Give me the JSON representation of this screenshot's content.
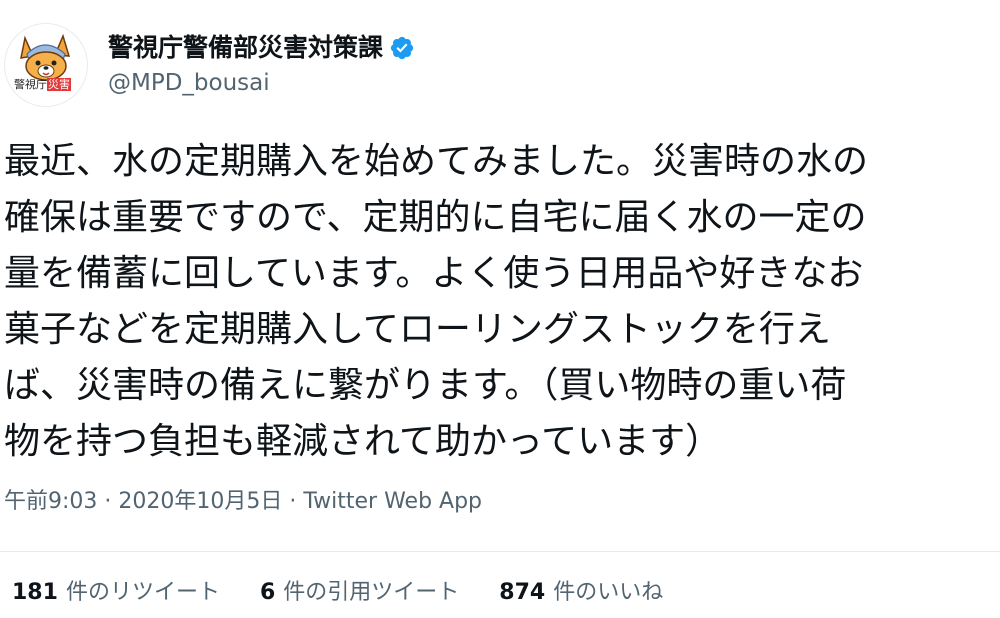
{
  "profile": {
    "display_name": "警視庁警備部災害対策課",
    "handle": "@MPD_bousai",
    "avatar_text_main": "警視庁",
    "avatar_text_tag": "災害",
    "verified_icon": "verified-badge-icon",
    "verified_color": "#1d9bf0"
  },
  "tweet": {
    "lines": [
      "最近、水の定期購入を始めてみました。災害時の水の",
      "確保は重要ですので、定期的に自宅に届く水の一定の",
      "量を備蓄に回しています。よく使う日用品や好きなお",
      "菓子などを定期購入してローリングストックを行え",
      "ば、災害時の備えに繋がります。（買い物時の重い荷",
      "物を持つ負担も軽減されて助かっています）"
    ]
  },
  "meta": {
    "time": "午前9:03",
    "separator1": " · ",
    "date": "2020年10月5日",
    "separator2": " · ",
    "app": "Twitter Web App"
  },
  "stats": {
    "retweets_count": "181",
    "retweets_label": "件のリツイート",
    "quotes_count": "6",
    "quotes_label": "件の引用ツイート",
    "likes_count": "874",
    "likes_label": "件のいいね"
  }
}
